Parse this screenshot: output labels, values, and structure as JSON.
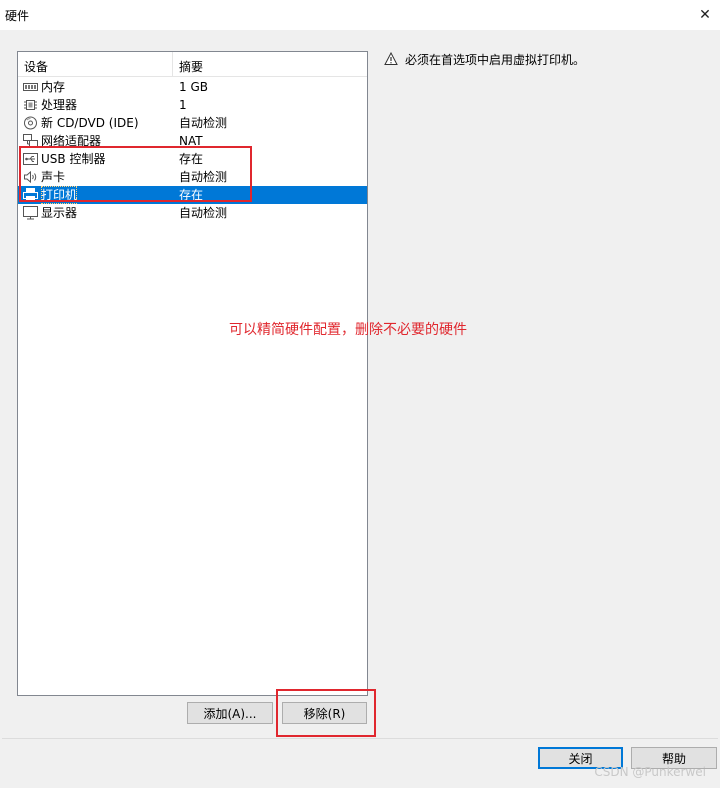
{
  "window": {
    "title": "硬件",
    "close_glyph": "✕"
  },
  "device_list": {
    "header_device": "设备",
    "header_summary": "摘要",
    "items": [
      {
        "name": "内存",
        "summary": "1 GB",
        "icon": "memory-icon"
      },
      {
        "name": "处理器",
        "summary": "1",
        "icon": "processor-icon"
      },
      {
        "name": "新 CD/DVD (IDE)",
        "summary": "自动检测",
        "icon": "cd-dvd-icon"
      },
      {
        "name": "网络适配器",
        "summary": "NAT",
        "icon": "network-adapter-icon"
      },
      {
        "name": "USB 控制器",
        "summary": "存在",
        "icon": "usb-controller-icon"
      },
      {
        "name": "声卡",
        "summary": "自动检测",
        "icon": "sound-card-icon"
      },
      {
        "name": "打印机",
        "summary": "存在",
        "icon": "printer-icon",
        "selected": true
      },
      {
        "name": "显示器",
        "summary": "自动检测",
        "icon": "display-icon"
      }
    ],
    "selection_color": "#0078d7"
  },
  "notice": {
    "text": "必须在首选项中启用虚拟打印机。",
    "icon": "warning-icon"
  },
  "annotation": {
    "text": "可以精简硬件配置，删除不必要的硬件",
    "color": "#e0272e"
  },
  "buttons": {
    "add": "添加(A)...",
    "remove": "移除(R)",
    "close": "关闭",
    "help": "帮助"
  },
  "watermark": "CSDN @Punkerwei"
}
